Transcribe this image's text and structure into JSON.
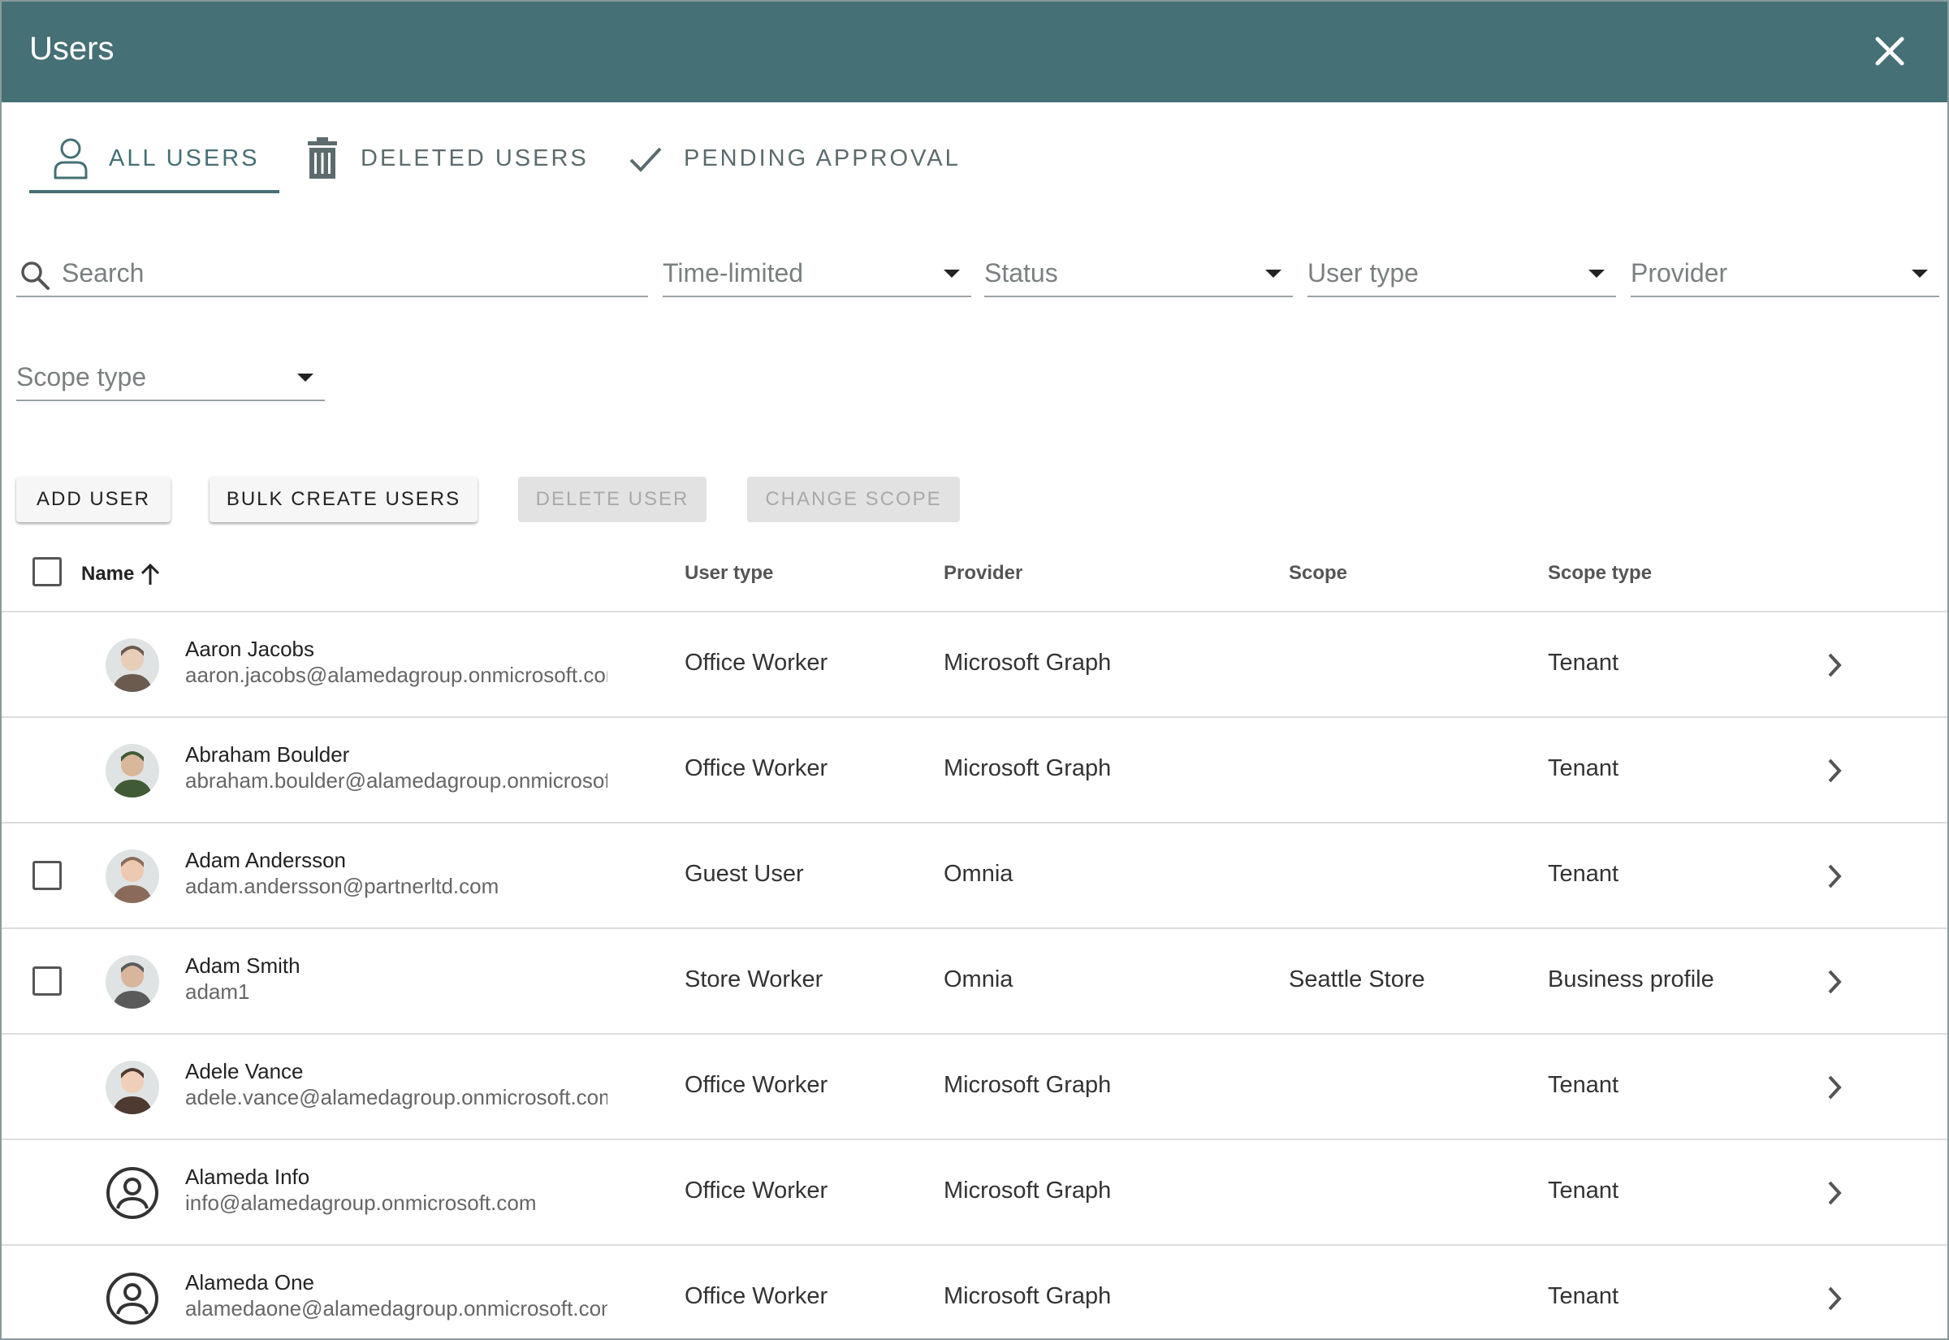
{
  "window": {
    "title": "Users"
  },
  "tabs": [
    {
      "label": "ALL USERS",
      "icon": "person-outline-icon",
      "active": true
    },
    {
      "label": "DELETED USERS",
      "icon": "trash-icon",
      "active": false
    },
    {
      "label": "PENDING APPROVAL",
      "icon": "check-icon",
      "active": false
    }
  ],
  "filters": {
    "search_placeholder": "Search",
    "time_limited": "Time-limited",
    "status": "Status",
    "user_type": "User type",
    "provider": "Provider",
    "scope_type": "Scope type"
  },
  "actions": {
    "add_user": "ADD USER",
    "bulk_create": "BULK CREATE USERS",
    "delete_user": "DELETE USER",
    "change_scope": "CHANGE SCOPE"
  },
  "table": {
    "columns": {
      "name": "Name",
      "user_type": "User type",
      "provider": "Provider",
      "scope": "Scope",
      "scope_type": "Scope type"
    },
    "sort": "ascending",
    "rows": [
      {
        "name": "Aaron Jacobs",
        "email": "aaron.jacobs@alamedagroup.onmicrosoft.com",
        "user_type": "Office Worker",
        "provider": "Microsoft Graph",
        "scope": "",
        "scope_type": "Tenant",
        "selectable": false,
        "avatar": "photo"
      },
      {
        "name": "Abraham Boulder",
        "email": "abraham.boulder@alamedagroup.onmicrosoft.com",
        "user_type": "Office Worker",
        "provider": "Microsoft Graph",
        "scope": "",
        "scope_type": "Tenant",
        "selectable": false,
        "avatar": "photo"
      },
      {
        "name": "Adam Andersson",
        "email": "adam.andersson@partnerltd.com",
        "user_type": "Guest User",
        "provider": "Omnia",
        "scope": "",
        "scope_type": "Tenant",
        "selectable": true,
        "avatar": "photo"
      },
      {
        "name": "Adam Smith",
        "email": "adam1",
        "user_type": "Store Worker",
        "provider": "Omnia",
        "scope": "Seattle Store",
        "scope_type": "Business profile",
        "selectable": true,
        "avatar": "photo"
      },
      {
        "name": "Adele Vance",
        "email": "adele.vance@alamedagroup.onmicrosoft.com",
        "user_type": "Office Worker",
        "provider": "Microsoft Graph",
        "scope": "",
        "scope_type": "Tenant",
        "selectable": false,
        "avatar": "photo"
      },
      {
        "name": "Alameda Info",
        "email": "info@alamedagroup.onmicrosoft.com",
        "user_type": "Office Worker",
        "provider": "Microsoft Graph",
        "scope": "",
        "scope_type": "Tenant",
        "selectable": false,
        "avatar": "account-circle-icon"
      },
      {
        "name": "Alameda One",
        "email": "alamedaone@alamedagroup.onmicrosoft.com",
        "user_type": "Office Worker",
        "provider": "Microsoft Graph",
        "scope": "",
        "scope_type": "Tenant",
        "selectable": false,
        "avatar": "account-circle-icon"
      }
    ]
  },
  "colors": {
    "header_bg": "#457075",
    "accent": "#457075",
    "divider": "#dcdcdc",
    "disabled_button": "#e2e2e2"
  }
}
